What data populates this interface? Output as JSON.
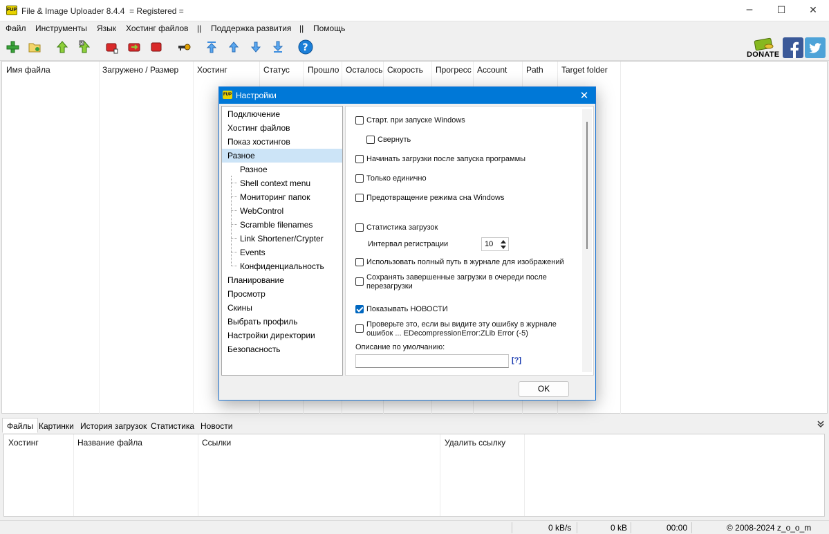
{
  "window": {
    "title": "File & Image Uploader 8.4.4  = Registered =",
    "logo_text": "FUP",
    "minimize": "─",
    "maximize": "☐",
    "close": "✕"
  },
  "menu": [
    "Файл",
    "Инструменты",
    "Язык",
    "Хостинг файлов",
    "||",
    "Поддержка развития",
    "||",
    "Помощь"
  ],
  "toolbar": {
    "donate_label": "DONATE",
    "icons": [
      "add-icon",
      "folder-icon",
      "upload-icon",
      "upload-all-icon",
      "stop-icon",
      "resume-icon",
      "stop-all-icon",
      "key-icon",
      "move-top-icon",
      "move-up-icon",
      "move-down-icon",
      "move-bottom-icon",
      "help-icon"
    ]
  },
  "columns": [
    "Имя файла",
    "Загружено / Размер",
    "Хостинг",
    "Статус",
    "Прошло",
    "Осталось",
    "Скорость",
    "Прогресс",
    "Account",
    "Path",
    "Target folder"
  ],
  "bottom_tabs": [
    "Файлы",
    "Картинки",
    "История загрузок",
    "Статистика",
    "Новости"
  ],
  "bottom_columns": [
    "Хостинг",
    "Название файла",
    "Ссылки",
    "Удалить ссылку"
  ],
  "status": {
    "speed": "0 kB/s",
    "size": "0 kB",
    "time": "00:00",
    "copyright": "© 2008-2024 z_o_o_m"
  },
  "dialog": {
    "title": "Настройки",
    "logo_text": "FUP",
    "close": "✕",
    "tree": [
      {
        "label": "Подключение",
        "sub": false
      },
      {
        "label": "Хостинг файлов",
        "sub": false
      },
      {
        "label": "Показ хостингов",
        "sub": false
      },
      {
        "label": "Разное",
        "sub": false,
        "selected": true
      },
      {
        "label": "Разное",
        "sub": true
      },
      {
        "label": "Shell context menu",
        "sub": true
      },
      {
        "label": "Мониторинг папок",
        "sub": true
      },
      {
        "label": "WebControl",
        "sub": true
      },
      {
        "label": "Scramble filenames",
        "sub": true
      },
      {
        "label": "Link Shortener/Crypter",
        "sub": true
      },
      {
        "label": "Events",
        "sub": true
      },
      {
        "label": "Конфиденциальность",
        "sub": true
      },
      {
        "label": "Планирование",
        "sub": false
      },
      {
        "label": "Просмотр",
        "sub": false
      },
      {
        "label": "Скины",
        "sub": false
      },
      {
        "label": "Выбрать профиль",
        "sub": false
      },
      {
        "label": "Настройки директории",
        "sub": false
      },
      {
        "label": "Безопасность",
        "sub": false
      }
    ],
    "options": {
      "start_windows": "Старт. при запуске Windows",
      "minimize": "Свернуть",
      "start_uploads": "Начинать загрузки после запуска программы",
      "single_instance": "Только единично",
      "prevent_sleep": "Предотвращение режима сна Windows",
      "upload_stats": "Статистика загрузок",
      "interval_label": "Интервал регистрации",
      "interval_value": "10",
      "full_path": "Использовать полный путь в журнале для изображений",
      "keep_completed_1": "Сохранять завершенные загрузки в очереди после",
      "keep_completed_2": "перезагрузки",
      "show_news": "Показывать НОВОСТИ",
      "zlib_1": "Проверьте это, если вы видите эту ошибку в журнале",
      "zlib_2": "ошибок ... EDecompressionError:ZLib Error (-5)",
      "desc_label": "Описание по умолчанию:",
      "desc_value": "",
      "help": "[?]",
      "show_news_checked": true
    },
    "ok": "OK"
  },
  "colors": {
    "accent": "#0078d7",
    "selection": "#cce4f7",
    "checkbox": "#0067c0"
  }
}
